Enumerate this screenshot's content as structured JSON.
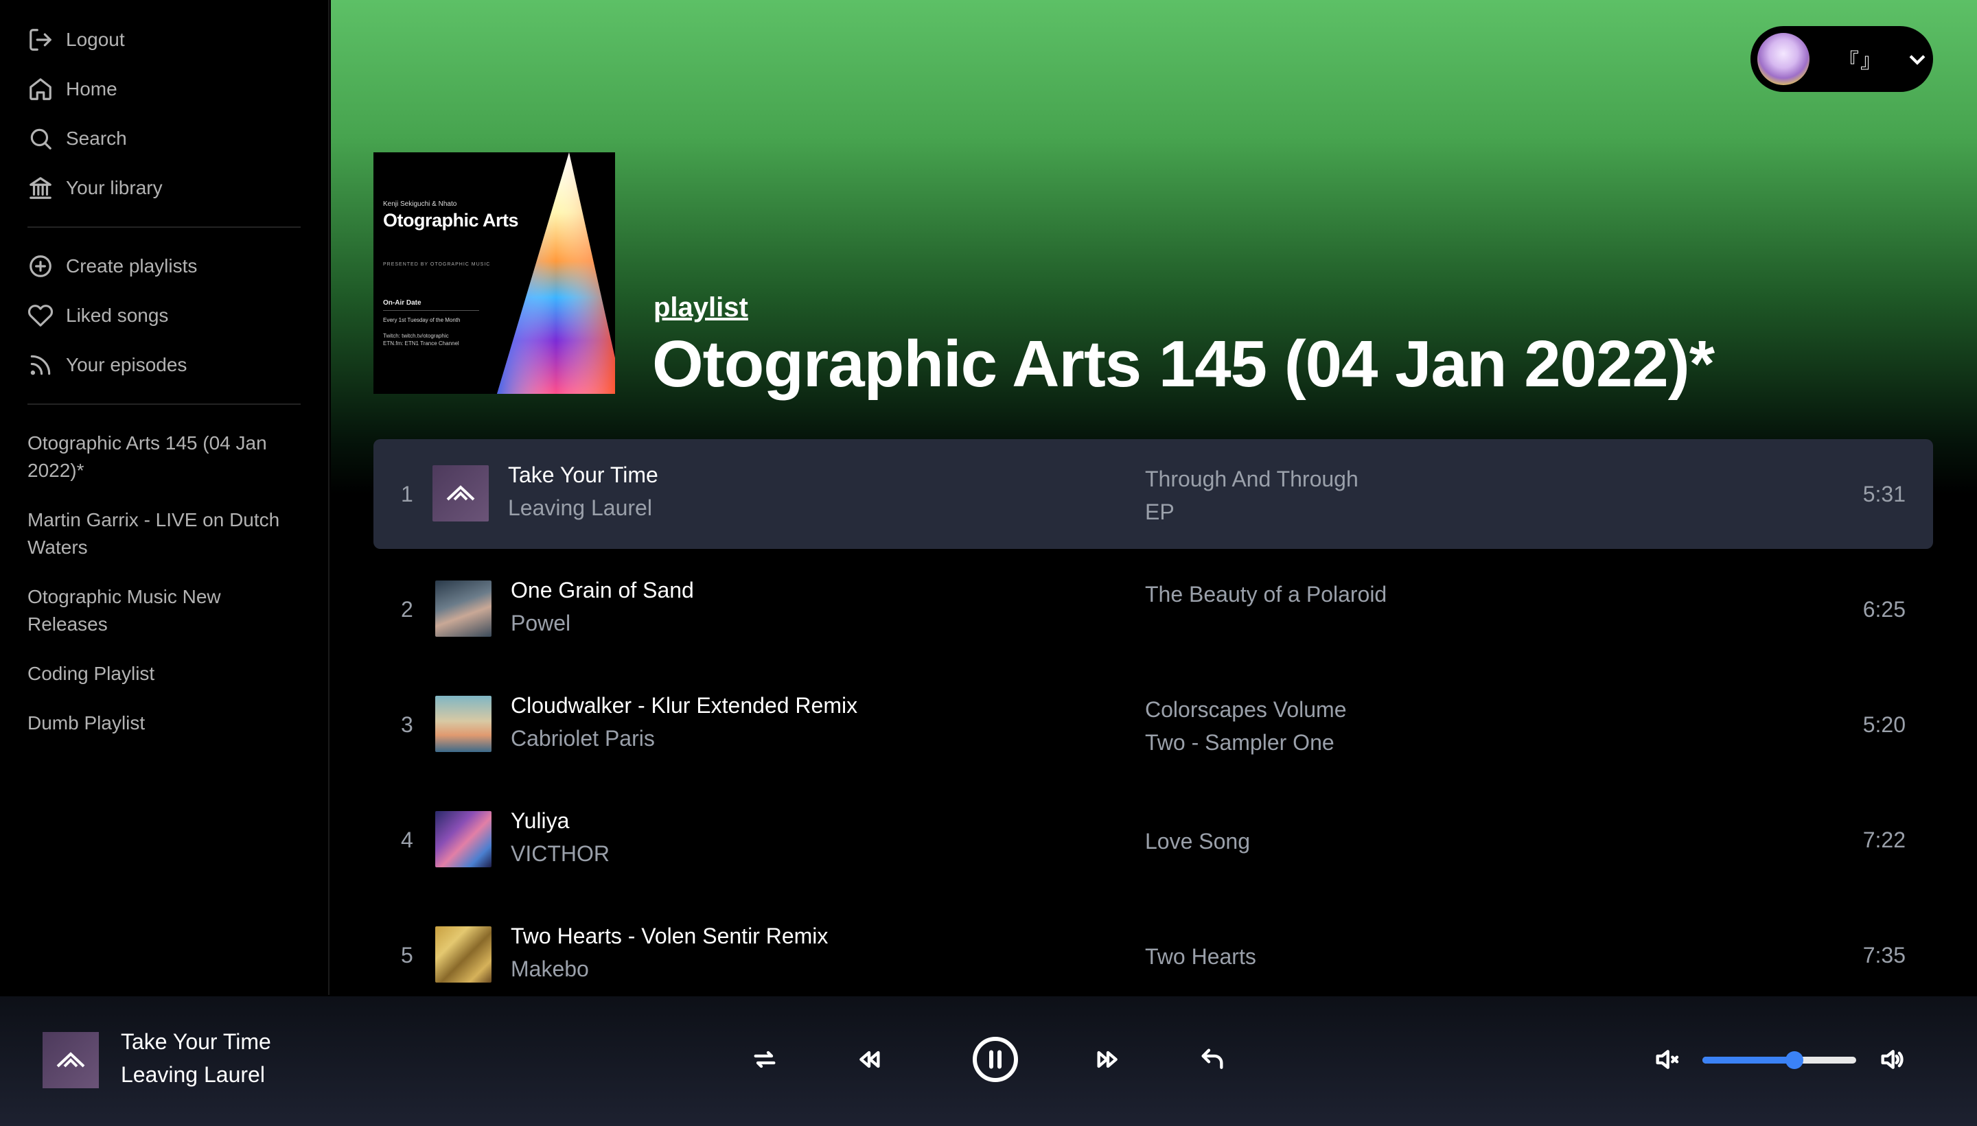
{
  "sidebar": {
    "nav": [
      {
        "label": "Logout",
        "icon": "logout-icon"
      },
      {
        "label": "Home",
        "icon": "home-icon"
      },
      {
        "label": "Search",
        "icon": "search-icon"
      },
      {
        "label": "Your library",
        "icon": "library-icon"
      }
    ],
    "actions": [
      {
        "label": "Create playlists",
        "icon": "plus-circle-icon"
      },
      {
        "label": "Liked songs",
        "icon": "heart-icon"
      },
      {
        "label": "Your episodes",
        "icon": "rss-icon"
      }
    ],
    "playlists": [
      "Otographic Arts 145 (04 Jan 2022)*",
      "Martin Garrix - LIVE on Dutch Waters",
      "Otographic Music New Releases",
      "Coding Playlist",
      "Dumb Playlist"
    ]
  },
  "user": {
    "name": "『』",
    "avatar_icon": "avatar-image",
    "menu_icon": "chevron-down-icon"
  },
  "header": {
    "label": "playlist",
    "title": "Otographic Arts 145 (04 Jan 2022)*",
    "cover": {
      "artists": "Kenji Sekiguchi & Nhato",
      "title": "Otographic Arts",
      "presented": "PRESENTED BY  OTOGRAPHIC MUSIC",
      "onair": "On-Air Date",
      "schedule": "Every 1st Tuesday of the Month",
      "twitch": "Twitch: twitch.tv/otographic",
      "fm": "ETN.fm: ETN1 Trance Channel"
    }
  },
  "tracks": [
    {
      "num": "1",
      "title": "Take Your Time",
      "artist": "Leaving Laurel",
      "album": "Through And Through EP",
      "duration": "5:31",
      "active": true
    },
    {
      "num": "2",
      "title": "One Grain of Sand",
      "artist": "Powel",
      "album": "The Beauty of a Polaroid",
      "duration": "6:25",
      "active": false
    },
    {
      "num": "3",
      "title": "Cloudwalker - Klur Extended Remix",
      "artist": "Cabriolet Paris",
      "album": "Colorscapes Volume Two - Sampler One",
      "duration": "5:20",
      "active": false
    },
    {
      "num": "4",
      "title": "Yuliya",
      "artist": "VICTHOR",
      "album": "Love Song",
      "duration": "7:22",
      "active": false
    },
    {
      "num": "5",
      "title": "Two Hearts - Volen Sentir Remix",
      "artist": "Makebo",
      "album": "Two Hearts",
      "duration": "7:35",
      "active": false
    }
  ],
  "player": {
    "title": "Take Your Time",
    "artist": "Leaving Laurel",
    "volume": 0.6,
    "controls": [
      "shuffle-icon",
      "previous-icon",
      "pause-icon",
      "next-icon",
      "repeat-icon"
    ],
    "mute_icon": "volume-mute-icon",
    "volume_icon": "volume-up-icon"
  },
  "colors": {
    "accent": "#3b82f6",
    "header_gradient_top": "#5dc066",
    "active_row": "#262b3a"
  }
}
